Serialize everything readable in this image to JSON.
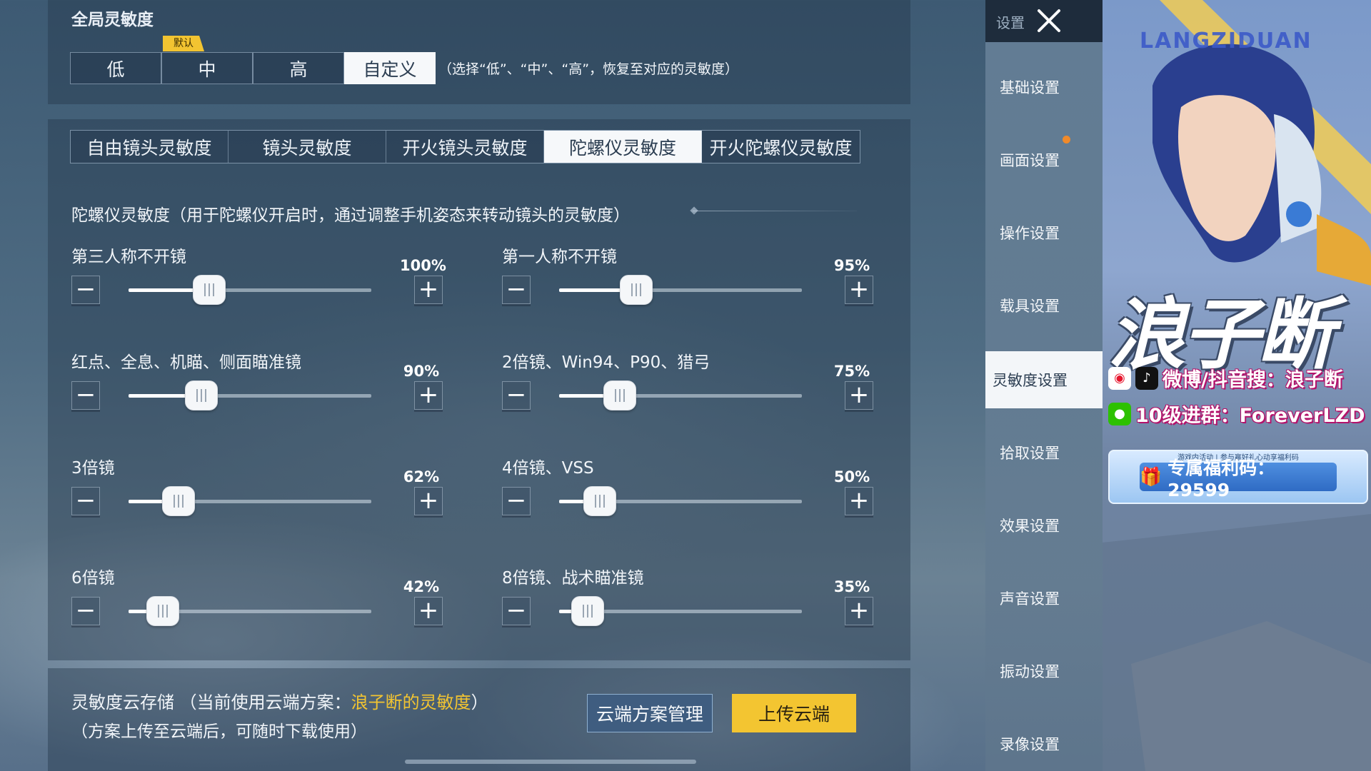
{
  "global": {
    "title": "全局灵敏度",
    "default_badge": "默认",
    "presets": [
      "低",
      "中",
      "高",
      "自定义"
    ],
    "active_preset": "自定义",
    "hint": "（选择“低”、“中”、“高”，恢复至对应的灵敏度）"
  },
  "tabs": [
    "自由镜头灵敏度",
    "镜头灵敏度",
    "开火镜头灵敏度",
    "陀螺仪灵敏度",
    "开火陀螺仪灵敏度"
  ],
  "active_tab": "陀螺仪灵敏度",
  "section_title": "陀螺仪灵敏度（用于陀螺仪开启时，通过调整手机姿态来转动镜头的灵敏度）",
  "sliders": [
    {
      "label": "第三人称不开镜",
      "value_text": "100%",
      "value": 100
    },
    {
      "label": "第一人称不开镜",
      "value_text": "95%",
      "value": 95
    },
    {
      "label": "红点、全息、机瞄、侧面瞄准镜",
      "value_text": "90%",
      "value": 90
    },
    {
      "label": "2倍镜、Win94、P90、猎弓",
      "value_text": "75%",
      "value": 75
    },
    {
      "label": "3倍镜",
      "value_text": "62%",
      "value": 62
    },
    {
      "label": "4倍镜、VSS",
      "value_text": "50%",
      "value": 50
    },
    {
      "label": "6倍镜",
      "value_text": "42%",
      "value": 42
    },
    {
      "label": "8倍镜、战术瞄准镜",
      "value_text": "35%",
      "value": 35
    }
  ],
  "slider_max": 300,
  "cloud": {
    "title": "灵敏度云存储",
    "current_prefix": "（当前使用云端方案：",
    "current_name": "浪子断的灵敏度",
    "current_suffix": "）",
    "subtitle": "（方案上传至云端后，可随时下载使用）",
    "manage_label": "云端方案管理",
    "upload_label": "上传云端"
  },
  "nav": {
    "header": "设置",
    "items": [
      "基础设置",
      "画面设置",
      "操作设置",
      "载具设置",
      "灵敏度设置",
      "拾取设置",
      "效果设置",
      "声音设置",
      "振动设置",
      "录像设置"
    ],
    "active": "灵敏度设置"
  },
  "overlay": {
    "brand": "LANGZIDUAN",
    "name": "浪子断",
    "line1": "微博/抖音搜：浪子断",
    "line2": "10级进群：ForeverLZD",
    "code_caption": "游戏内活动 | 参与赢好礼心动享福利码",
    "code_label": "专属福利码：29599"
  },
  "colors": {
    "accent_yellow": "#f3c531",
    "active_white": "#f6f8fa",
    "nav_dot": "#f08a2a"
  }
}
